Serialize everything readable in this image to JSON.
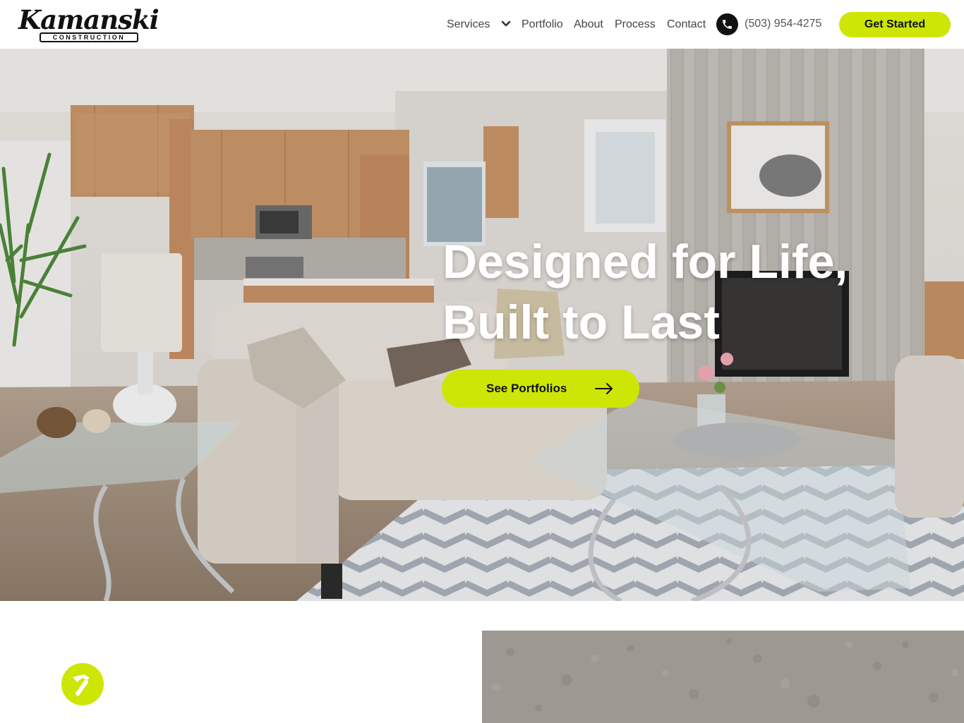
{
  "brand": {
    "logo_script": "Kamanski",
    "logo_sub": "CONSTRUCTION"
  },
  "nav": {
    "items": [
      "Services",
      "Portfolio",
      "About",
      "Process",
      "Contact"
    ],
    "phone": "(503) 954-4275",
    "cta_label": "Get Started"
  },
  "hero": {
    "headline_line1": "Designed for Life,",
    "headline_line2": "Built to Last",
    "button_label": "See Portfolios"
  },
  "icons": {
    "services_dropdown": "chevron-down-icon",
    "phone": "phone-icon",
    "button_arrow": "arrow-right-icon",
    "badge": "hammer-icon"
  },
  "colors": {
    "accent": "#cde605",
    "text": "#111111",
    "nav_text": "#444444"
  }
}
